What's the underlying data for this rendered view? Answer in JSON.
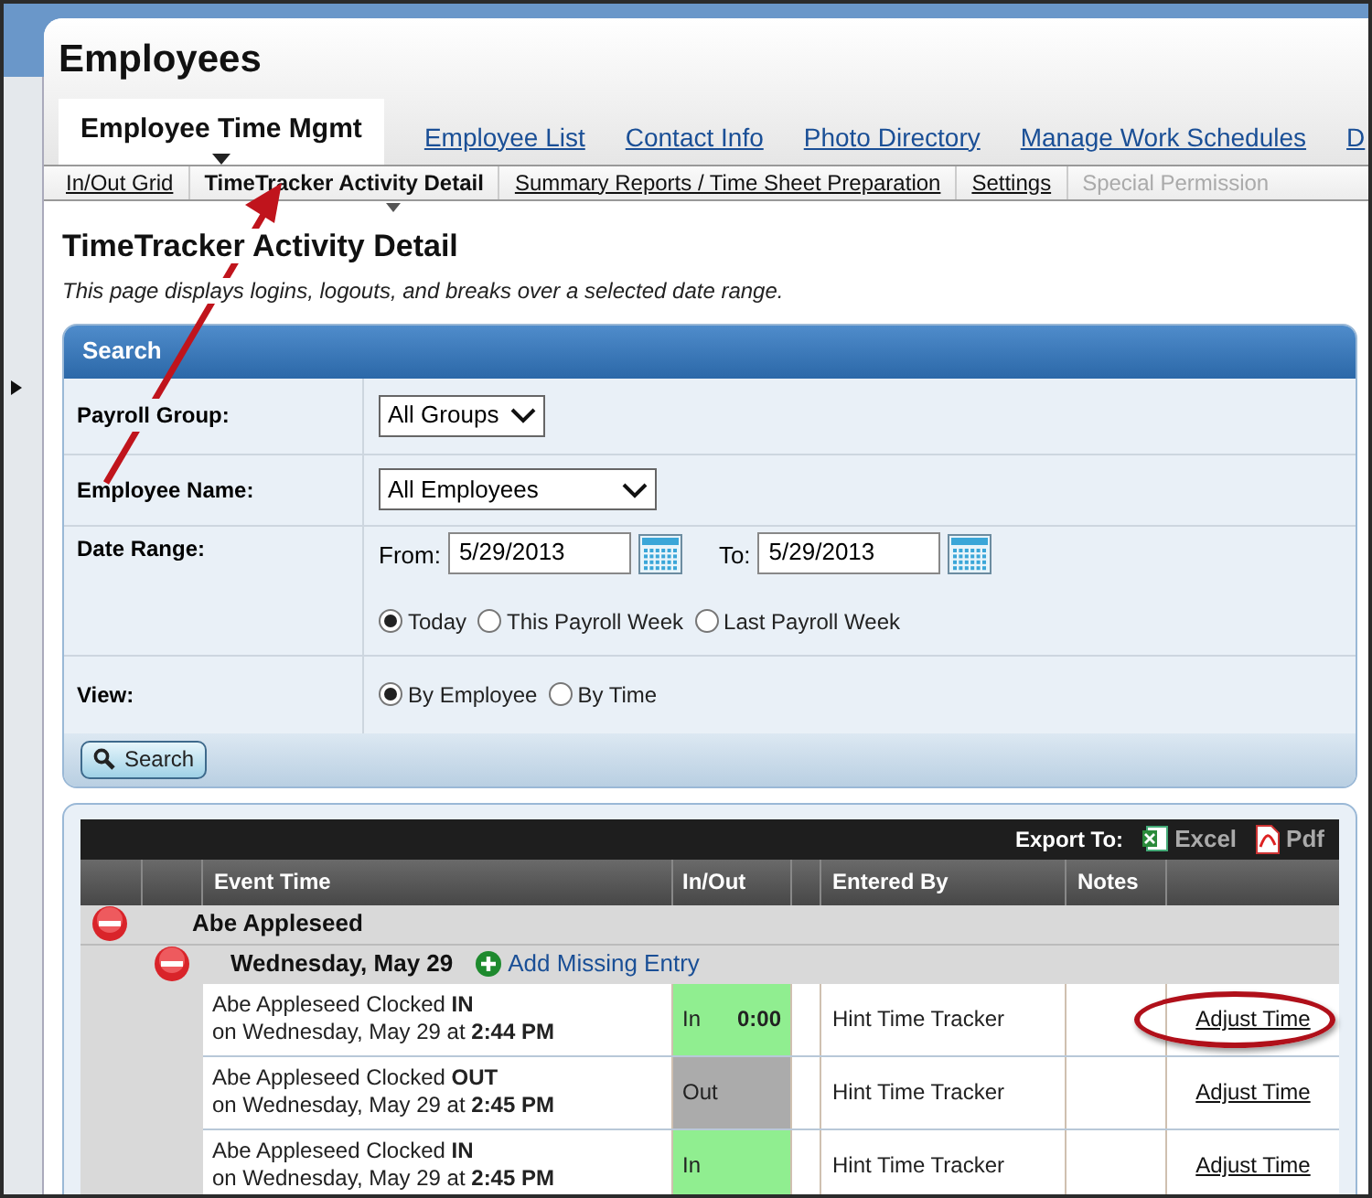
{
  "page": {
    "title": "Employees"
  },
  "tabs": [
    {
      "label": "Employee Time Mgmt",
      "selected": true
    },
    {
      "label": "Employee List",
      "selected": false
    },
    {
      "label": "Contact Info",
      "selected": false
    },
    {
      "label": "Photo Directory",
      "selected": false
    },
    {
      "label": "Manage Work Schedules",
      "selected": false
    },
    {
      "label": "D",
      "selected": false
    }
  ],
  "subtabs": [
    {
      "label": "In/Out Grid",
      "selected": false,
      "disabled": false
    },
    {
      "label": "TimeTracker Activity Detail",
      "selected": true,
      "disabled": false
    },
    {
      "label": "Summary Reports / Time Sheet Preparation",
      "selected": false,
      "disabled": false
    },
    {
      "label": "Settings",
      "selected": false,
      "disabled": false
    },
    {
      "label": "Special Permission",
      "selected": false,
      "disabled": true
    }
  ],
  "heading": "TimeTracker Activity Detail",
  "description": "This page displays logins, logouts, and breaks over a selected date range.",
  "search": {
    "title": "Search",
    "payroll_group": {
      "label": "Payroll Group:",
      "value": "All Groups"
    },
    "employee_name": {
      "label": "Employee Name:",
      "value": "All Employees"
    },
    "date_range": {
      "label": "Date Range:",
      "from_label": "From:",
      "from_value": "5/29/2013",
      "to_label": "To:",
      "to_value": "5/29/2013",
      "options": [
        {
          "label": "Today",
          "selected": true
        },
        {
          "label": "This Payroll Week",
          "selected": false
        },
        {
          "label": "Last Payroll Week",
          "selected": false
        }
      ]
    },
    "view": {
      "label": "View:",
      "options": [
        {
          "label": "By Employee",
          "selected": true
        },
        {
          "label": "By Time",
          "selected": false
        }
      ]
    },
    "button": "Search"
  },
  "results": {
    "export_label": "Export To:",
    "exports": [
      {
        "label": "Excel",
        "kind": "excel"
      },
      {
        "label": "Pdf",
        "kind": "pdf"
      }
    ],
    "columns": [
      "Event Time",
      "In/Out",
      "Entered By",
      "Notes"
    ],
    "employee": "Abe Appleseed",
    "day": "Wednesday, May 29",
    "add_link": "Add Missing Entry",
    "rows": [
      {
        "event": "Abe Appleseed Clocked **IN**",
        "when": "on Wednesday, May 29 at **2:44 PM**",
        "kind": "in",
        "in_out": "In",
        "duration": "0:00",
        "entered_by": "Hint Time Tracker",
        "action": "Adjust Time",
        "circled": true
      },
      {
        "event": "Abe Appleseed Clocked **OUT**",
        "when": "on Wednesday, May 29 at **2:45 PM**",
        "kind": "out",
        "in_out": "Out",
        "entered_by": "Hint Time Tracker",
        "action": "Adjust Time",
        "circled": false
      },
      {
        "event": "Abe Appleseed Clocked **IN**",
        "when": "on Wednesday, May 29 at **2:45 PM**",
        "kind": "in",
        "in_out": "In",
        "entered_by": "Hint Time Tracker",
        "action": "Adjust Time",
        "circled": false
      }
    ]
  }
}
